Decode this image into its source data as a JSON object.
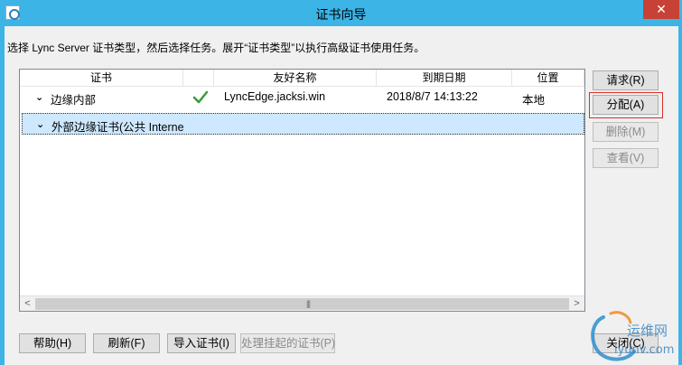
{
  "window": {
    "title": "证书向导",
    "close_label": "✕"
  },
  "instruction": "选择 Lync Server 证书类型，然后选择任务。展开“证书类型”以执行高级证书使用任务。",
  "table": {
    "columns": [
      "证书",
      "",
      "友好名称",
      "到期日期",
      "位置"
    ],
    "rows": [
      {
        "name": "边缘内部",
        "status": "valid",
        "friendly_name": "LyncEdge.jacksi.win",
        "expiry": "2018/8/7 14:13:22",
        "location": "本地"
      },
      {
        "name": "外部边缘证书(公共 Interne",
        "status": "",
        "friendly_name": "",
        "expiry": "",
        "location": ""
      }
    ],
    "scroll_left": "<",
    "scroll_right": ">",
    "scroll_grip": "|||"
  },
  "side_buttons": {
    "request": "请求(R)",
    "assign": "分配(A)",
    "remove": "删除(M)",
    "view": "查看(V)"
  },
  "bottom_buttons": {
    "help": "帮助(H)",
    "refresh": "刷新(F)",
    "import": "导入证书(I)",
    "pending": "处理挂起的证书(P)",
    "close": "关闭(C)"
  },
  "watermark": {
    "cn": "运维网",
    "en": "iyunv.com"
  },
  "colors": {
    "titlebar": "#3db4e6",
    "close": "#c74135",
    "selection": "#cde8ff",
    "check": "#3a9a3a",
    "focus": "#d9302a"
  }
}
